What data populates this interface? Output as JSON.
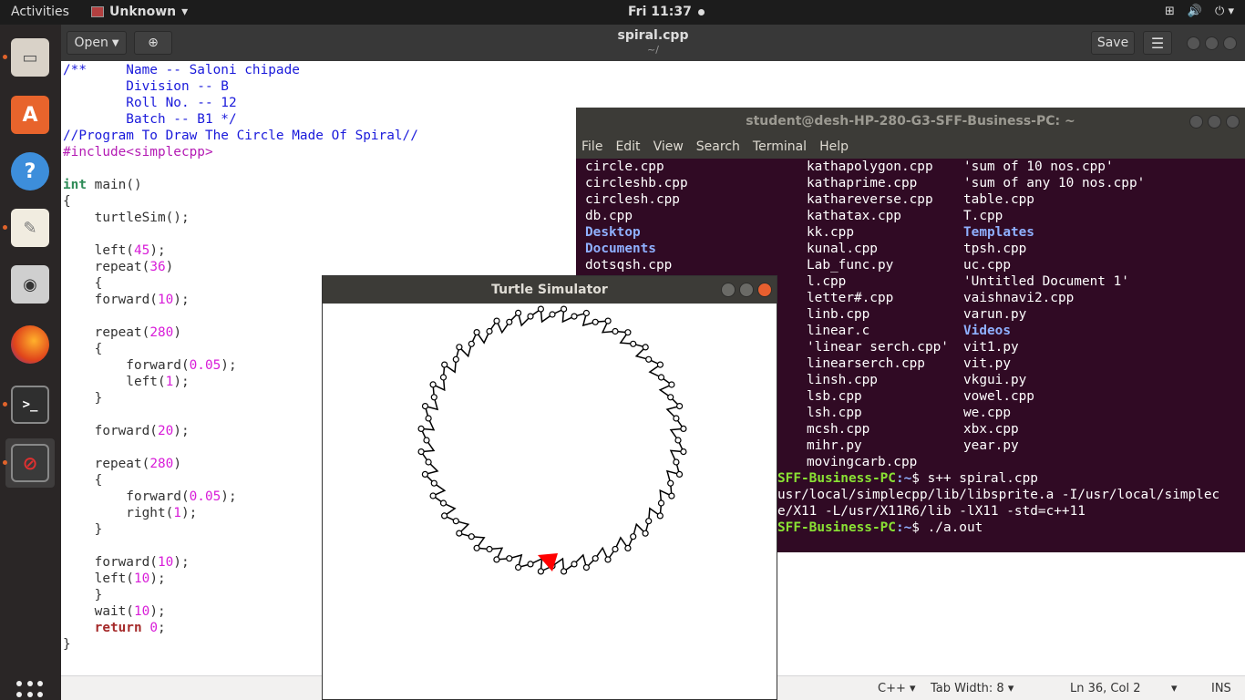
{
  "topbar": {
    "activities": "Activities",
    "app_name": "Unknown",
    "clock": "Fri 11:37"
  },
  "dock": {
    "items": [
      {
        "icon": "files-icon"
      },
      {
        "icon": "software-center-icon"
      },
      {
        "icon": "help-icon"
      },
      {
        "icon": "text-editor-icon"
      },
      {
        "icon": "screenshot-icon"
      },
      {
        "icon": "firefox-icon"
      },
      {
        "icon": "terminal-icon"
      },
      {
        "icon": "unknown-app-icon"
      }
    ],
    "show_apps_icon": "grid-icon"
  },
  "gedit": {
    "open_label": "Open",
    "title": "spiral.cpp",
    "subtitle": "~/",
    "save_label": "Save",
    "status": {
      "language": "C++",
      "tab_width": "Tab Width: 8",
      "position": "Ln 36, Col 2",
      "mode": "INS"
    },
    "lines": [
      [
        [
          "c-com",
          "/**     Name -- Saloni chipade"
        ]
      ],
      [
        [
          "c-com",
          "        Division -- B"
        ]
      ],
      [
        [
          "c-com",
          "        Roll No. -- 12"
        ]
      ],
      [
        [
          "c-com",
          "        Batch -- B1 */"
        ]
      ],
      [
        [
          "c-com",
          "//Program To Draw The Circle Made Of Spiral//"
        ]
      ],
      [
        [
          "c-pre",
          "#include<simplecpp>"
        ]
      ],
      [
        [
          "",
          ""
        ]
      ],
      [
        [
          "c-type",
          "int"
        ],
        [
          "",
          " main()"
        ]
      ],
      [
        [
          "",
          "{"
        ]
      ],
      [
        [
          "",
          "    turtleSim();"
        ]
      ],
      [
        [
          "",
          ""
        ]
      ],
      [
        [
          "",
          "    left("
        ],
        [
          "c-num",
          "45"
        ],
        [
          "",
          ");"
        ]
      ],
      [
        [
          "",
          "    repeat("
        ],
        [
          "c-num",
          "36"
        ],
        [
          "",
          ")"
        ]
      ],
      [
        [
          "",
          "    {"
        ]
      ],
      [
        [
          "",
          "    forward("
        ],
        [
          "c-num",
          "10"
        ],
        [
          "",
          ");"
        ]
      ],
      [
        [
          "",
          ""
        ]
      ],
      [
        [
          "",
          "    repeat("
        ],
        [
          "c-num",
          "280"
        ],
        [
          "",
          ")"
        ]
      ],
      [
        [
          "",
          "    {"
        ]
      ],
      [
        [
          "",
          "        forward("
        ],
        [
          "c-num",
          "0.05"
        ],
        [
          "",
          ");"
        ]
      ],
      [
        [
          "",
          "        left("
        ],
        [
          "c-num",
          "1"
        ],
        [
          "",
          ");"
        ]
      ],
      [
        [
          "",
          "    }"
        ]
      ],
      [
        [
          "",
          ""
        ]
      ],
      [
        [
          "",
          "    forward("
        ],
        [
          "c-num",
          "20"
        ],
        [
          "",
          ");"
        ]
      ],
      [
        [
          "",
          ""
        ]
      ],
      [
        [
          "",
          "    repeat("
        ],
        [
          "c-num",
          "280"
        ],
        [
          "",
          ")"
        ]
      ],
      [
        [
          "",
          "    {"
        ]
      ],
      [
        [
          "",
          "        forward("
        ],
        [
          "c-num",
          "0.05"
        ],
        [
          "",
          ");"
        ]
      ],
      [
        [
          "",
          "        right("
        ],
        [
          "c-num",
          "1"
        ],
        [
          "",
          ");"
        ]
      ],
      [
        [
          "",
          "    }"
        ]
      ],
      [
        [
          "",
          ""
        ]
      ],
      [
        [
          "",
          "    forward("
        ],
        [
          "c-num",
          "10"
        ],
        [
          "",
          ");"
        ]
      ],
      [
        [
          "",
          "    left("
        ],
        [
          "c-num",
          "10"
        ],
        [
          "",
          ");"
        ]
      ],
      [
        [
          "",
          "    }"
        ]
      ],
      [
        [
          "",
          "    wait("
        ],
        [
          "c-num",
          "10"
        ],
        [
          "",
          ");"
        ]
      ],
      [
        [
          "c-kw",
          "    return"
        ],
        [
          "",
          " "
        ],
        [
          "c-num",
          "0"
        ],
        [
          "",
          ";"
        ]
      ],
      [
        [
          "",
          "}"
        ]
      ]
    ]
  },
  "terminal": {
    "title": "student@desh-HP-280-G3-SFF-Business-PC: ~",
    "menu": [
      "File",
      "Edit",
      "View",
      "Search",
      "Terminal",
      "Help"
    ],
    "col1": [
      [
        "",
        "circle.cpp"
      ],
      [
        "",
        "circleshb.cpp"
      ],
      [
        "",
        "circlesh.cpp"
      ],
      [
        "",
        "db.cpp"
      ],
      [
        "t-dir",
        "Desktop"
      ],
      [
        "t-dir",
        "Documents"
      ],
      [
        "",
        "dotsqsh.cpp"
      ]
    ],
    "col2": [
      "kathapolygon.cpp",
      "kathaprime.cpp",
      "kathareverse.cpp",
      "kathatax.cpp",
      "kk.cpp",
      "kunal.cpp",
      "Lab_func.py",
      "l.cpp",
      "letter#.cpp",
      "linb.cpp",
      "linear.c",
      "'linear serch.cpp'",
      "linearserch.cpp",
      "linsh.cpp",
      "lsb.cpp",
      "lsh.cpp",
      "mcsh.cpp",
      "mihr.py",
      "movingcarb.cpp"
    ],
    "col3": [
      [
        "",
        "'sum of 10 nos.cpp'"
      ],
      [
        "",
        "'sum of any 10 nos.cpp'"
      ],
      [
        "",
        "table.cpp"
      ],
      [
        "",
        "T.cpp"
      ],
      [
        "t-dir",
        "Templates"
      ],
      [
        "",
        "tpsh.cpp"
      ],
      [
        "",
        "uc.cpp"
      ],
      [
        "",
        "'Untitled Document 1'"
      ],
      [
        "",
        "vaishnavi2.cpp"
      ],
      [
        "",
        "varun.py"
      ],
      [
        "t-dir",
        "Videos"
      ],
      [
        "",
        "vit1.py"
      ],
      [
        "",
        "vit.py"
      ],
      [
        "",
        "vkgui.py"
      ],
      [
        "",
        "vowel.cpp"
      ],
      [
        "",
        "we.cpp"
      ],
      [
        "",
        "xbx.cpp"
      ],
      [
        "",
        "year.py"
      ]
    ],
    "cmd1_prompt": "SFF-Business-PC",
    "cmd1_path": ":~",
    "cmd1": "$ s++ spiral.cpp",
    "cmd1_out1": "usr/local/simplecpp/lib/libsprite.a -I/usr/local/simplec",
    "cmd1_out2": "e/X11 -L/usr/X11R6/lib -lX11 -std=c++11",
    "cmd2_prompt": "SFF-Business-PC",
    "cmd2_path": ":~",
    "cmd2": "$ ./a.out"
  },
  "turtle": {
    "title": "Turtle Simulator",
    "turtle_color": "#ff0000"
  }
}
